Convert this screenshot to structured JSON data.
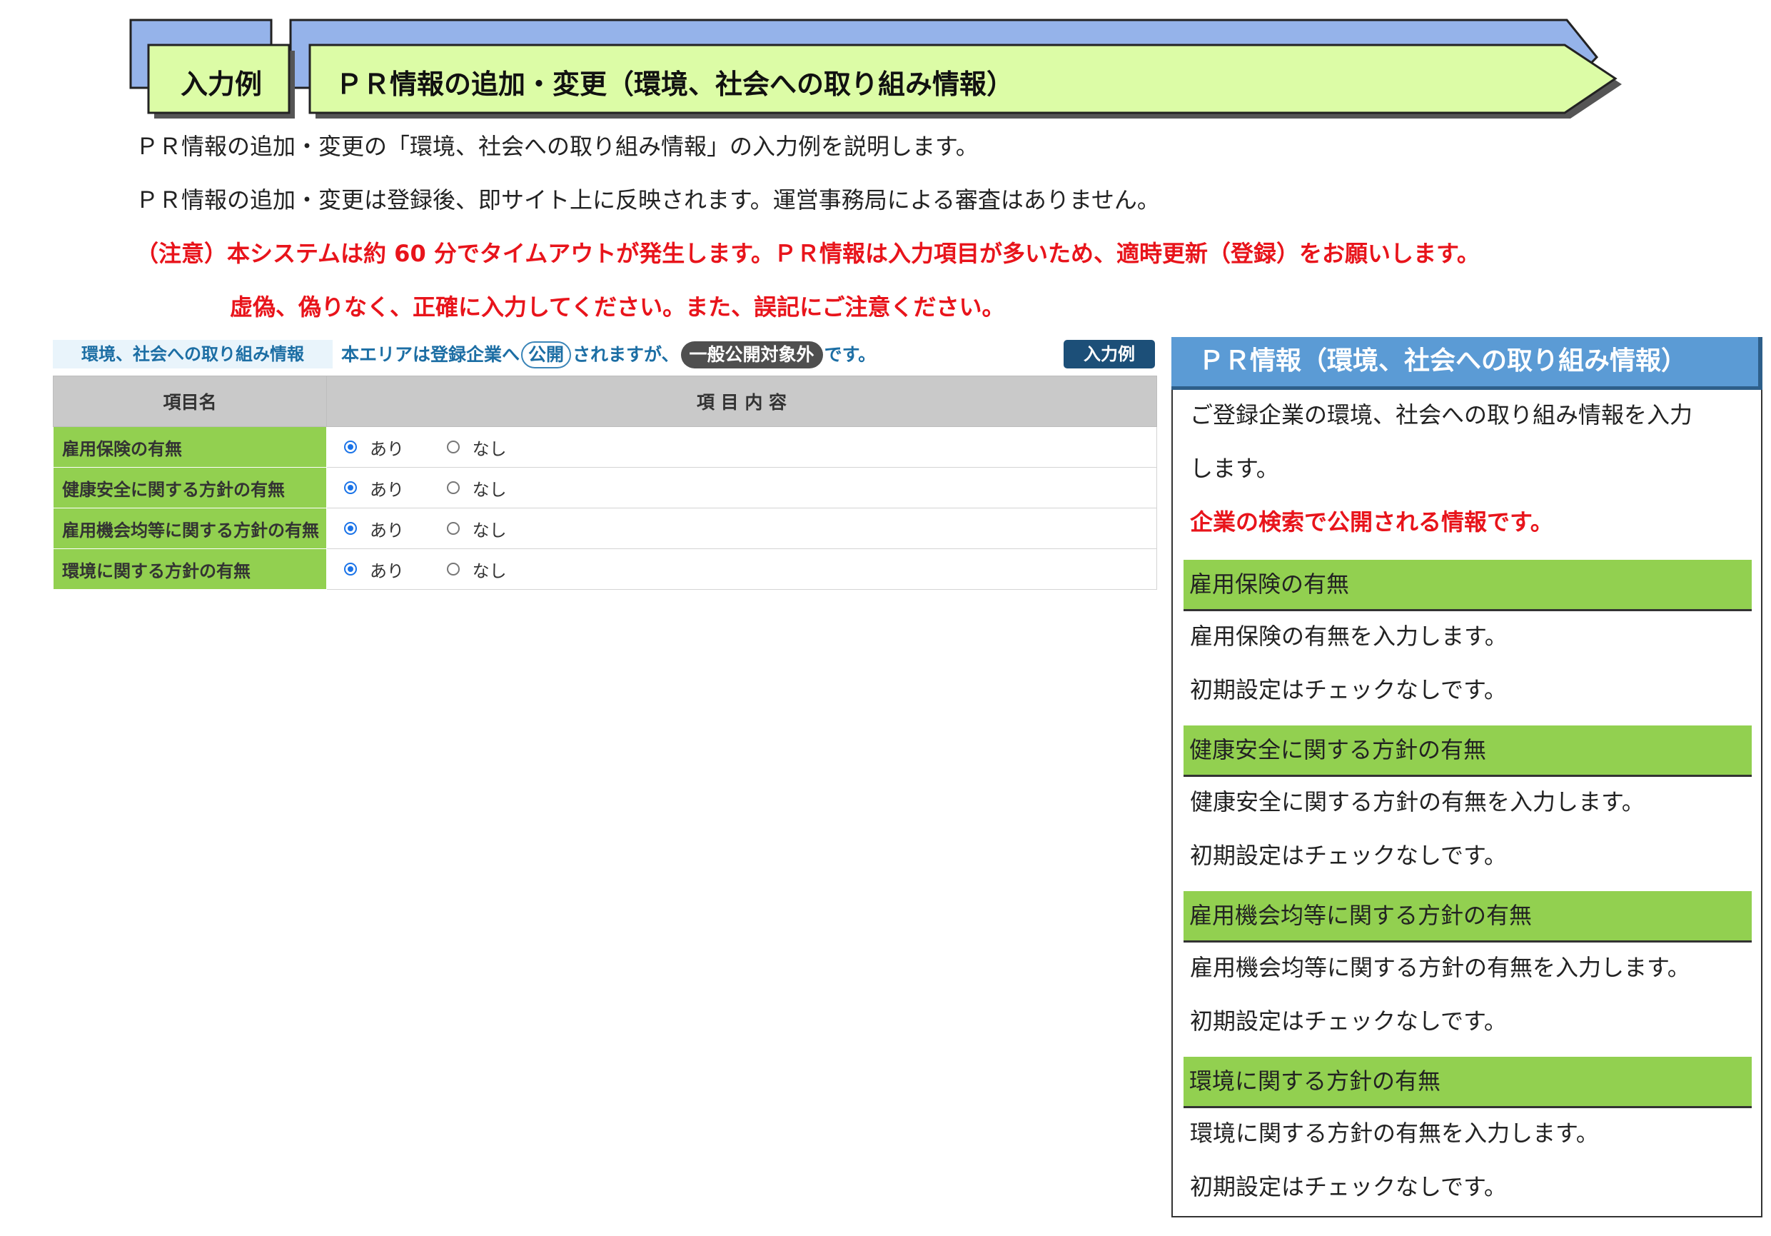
{
  "header": {
    "label": "入力例",
    "title": "ＰＲ情報の追加・変更（環境、社会への取り組み情報）"
  },
  "intro": {
    "line1": "ＰＲ情報の追加・変更の「環境、社会への取り組み情報」の入力例を説明します。",
    "line2": "ＰＲ情報の追加・変更は登録後、即サイト上に反映されます。運営事務局による審査はありません。",
    "warning1": "（注意）本システムは約 60 分でタイムアウトが発生します。ＰＲ情報は入力項目が多いため、適時更新（登録）をお願いします。",
    "warning2": "虚偽、偽りなく、正確に入力してください。また、誤記にご注意ください。"
  },
  "form": {
    "tag": "環境、社会への取り組み情報",
    "note_prefix": "本エリアは登録企業へ",
    "note_public": "公開",
    "note_middle": "されますが、",
    "note_excluded": "一般公開対象外",
    "note_suffix": "です。",
    "example_button": "入力例",
    "columns": [
      "項目名",
      "項 目 内 容"
    ],
    "rows": [
      {
        "label": "雇用保険の有無",
        "yes": "あり",
        "no": "なし"
      },
      {
        "label": "健康安全に関する方針の有無",
        "yes": "あり",
        "no": "なし"
      },
      {
        "label": "雇用機会均等に関する方針の有無",
        "yes": "あり",
        "no": "なし"
      },
      {
        "label": "環境に関する方針の有無",
        "yes": "あり",
        "no": "なし"
      }
    ]
  },
  "panel": {
    "title": "ＰＲ情報（環境、社会への取り組み情報）",
    "desc1": "ご登録企業の環境、社会への取り組み情報を入力",
    "desc2": "します。",
    "public_note": "企業の検索で公開される情報です。",
    "sections": [
      {
        "heading": "雇用保険の有無",
        "text": "雇用保険の有無を入力します。",
        "default": "初期設定はチェックなしです。"
      },
      {
        "heading": "健康安全に関する方針の有無",
        "text": "健康安全に関する方針の有無を入力します。",
        "default": "初期設定はチェックなしです。"
      },
      {
        "heading": "雇用機会均等に関する方針の有無",
        "text": "雇用機会均等に関する方針の有無を入力します。",
        "default": "初期設定はチェックなしです。"
      },
      {
        "heading": "環境に関する方針の有無",
        "text": "環境に関する方針の有無を入力します。",
        "default": "初期設定はチェックなしです。"
      }
    ]
  }
}
